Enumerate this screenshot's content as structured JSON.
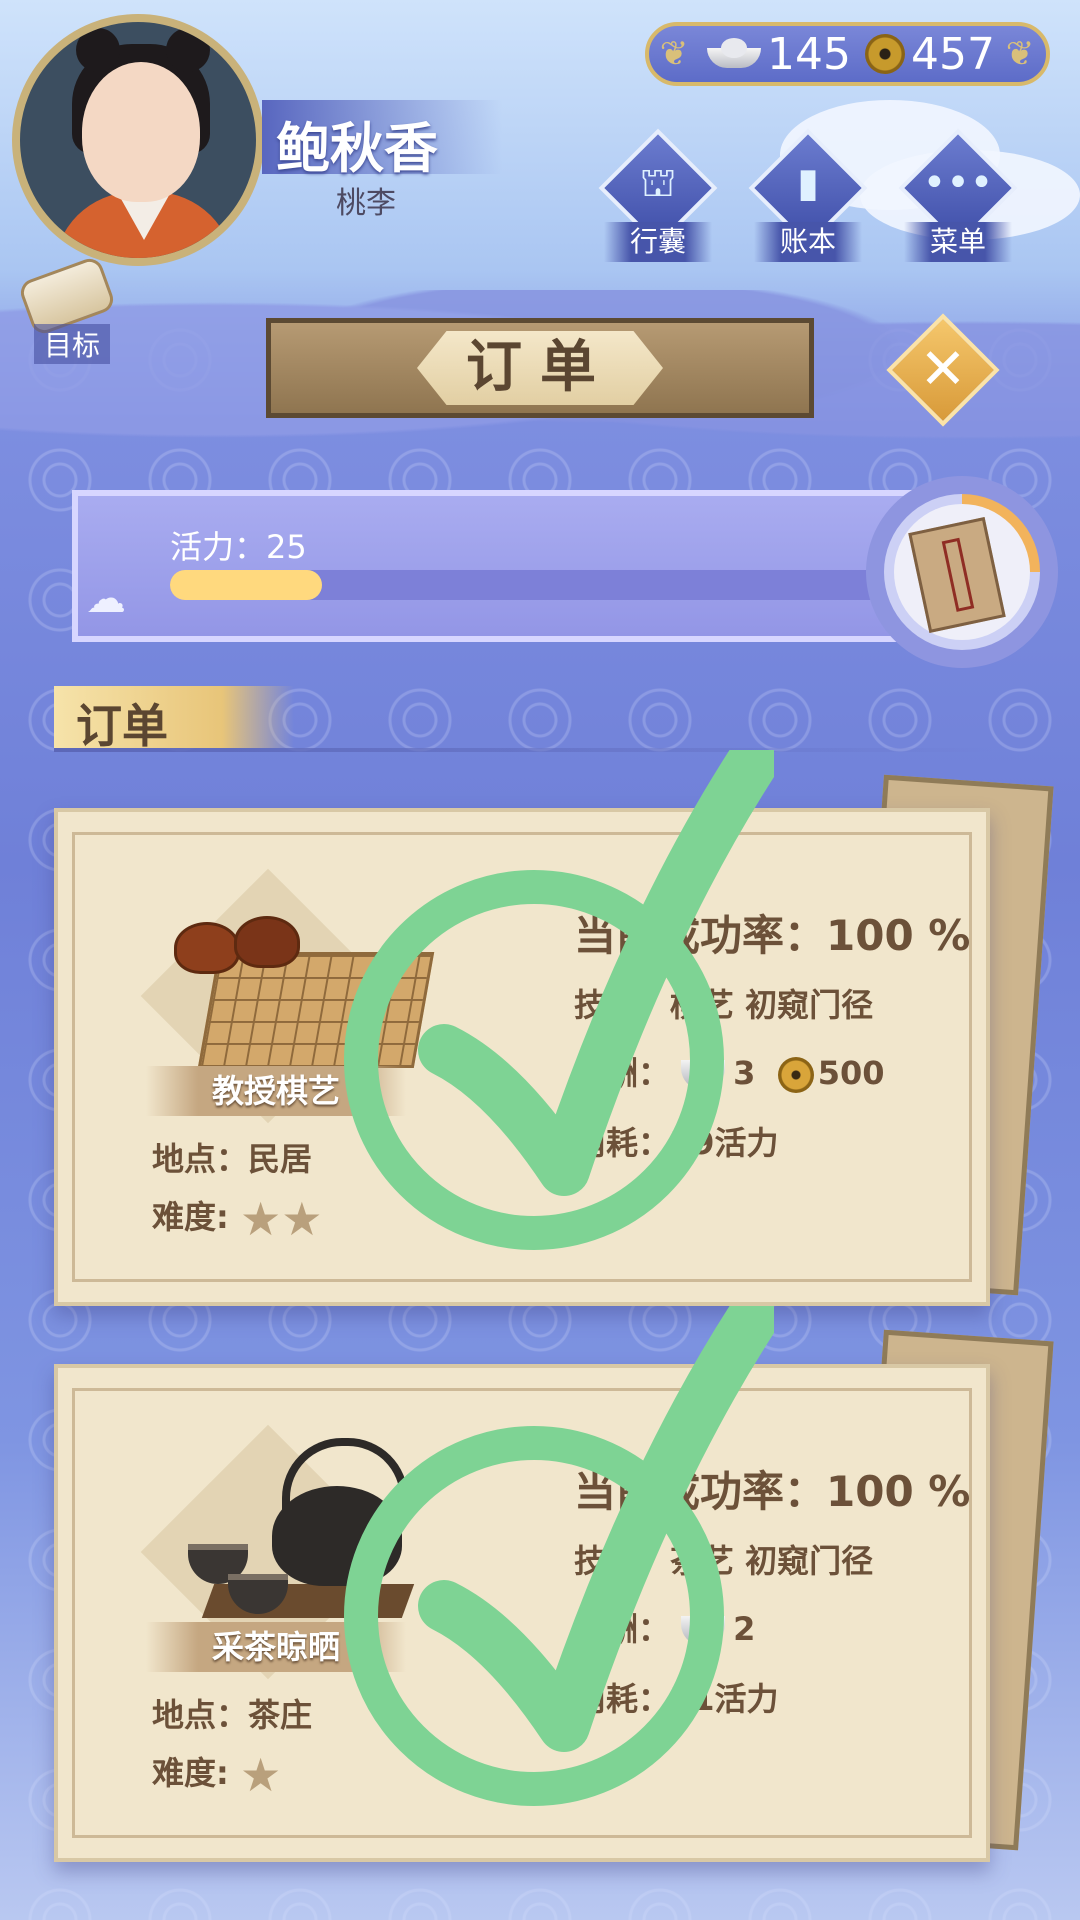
{
  "currency": {
    "silver": "145",
    "coins": "457"
  },
  "player": {
    "name": "鲍秋香",
    "title": "桃李"
  },
  "goal_label": "目标",
  "top_menu": [
    {
      "label": "行囊",
      "icon": "bundle-icon"
    },
    {
      "label": "账本",
      "icon": "ledger-icon"
    },
    {
      "label": "菜单",
      "icon": "more-icon"
    }
  ],
  "header": {
    "title": "订单"
  },
  "energy": {
    "label": "活力：25",
    "value": 25,
    "fill_fraction": 0.2
  },
  "section": {
    "title": "订单"
  },
  "orders": [
    {
      "name": "教授棋艺",
      "location": "地点：民居",
      "difficulty_label": "难度:",
      "stars": 2,
      "success_rate": "当前成功率：100 %",
      "skill": "技艺：棋艺 初窥门径",
      "reward_label": "报酬：",
      "reward_silver": "3",
      "reward_coins": "500",
      "cost": "消耗：29活力",
      "completed": true
    },
    {
      "name": "采茶晾晒",
      "location": "地点：茶庄",
      "difficulty_label": "难度:",
      "stars": 1,
      "success_rate": "当前成功率：100 %",
      "skill": "技艺：茶艺 初窥门径",
      "reward_label": "报酬：",
      "reward_silver": "2",
      "reward_coins": "",
      "cost": "消耗：21活力",
      "completed": true
    }
  ],
  "colors": {
    "accent_gold": "#d8b96a",
    "check_green": "#7ed394",
    "card_bg": "#f1e6cc",
    "text_brown": "#6c5139"
  }
}
